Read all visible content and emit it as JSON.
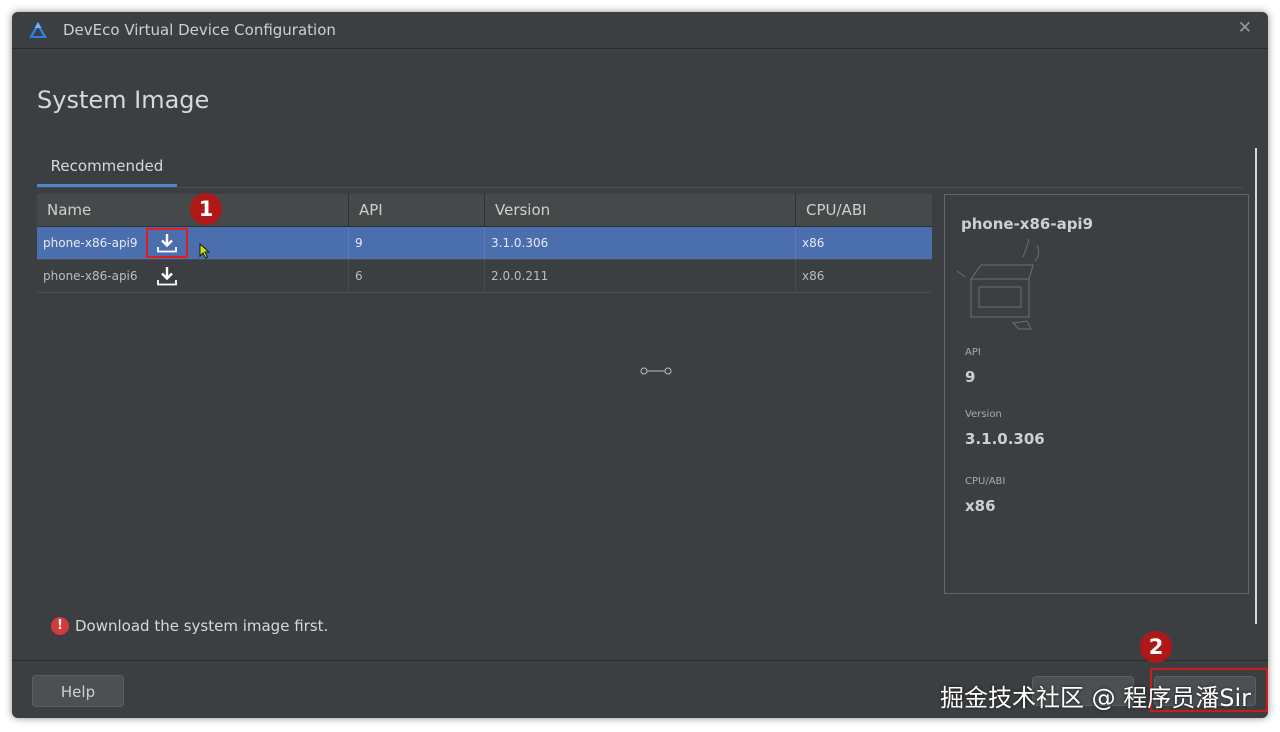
{
  "window": {
    "title": "DevEco Virtual Device Configuration"
  },
  "page": {
    "title": "System Image"
  },
  "tabs": [
    {
      "label": "Recommended",
      "selected": true
    }
  ],
  "table": {
    "headers": [
      "Name",
      "API",
      "Version",
      "CPU/ABI"
    ],
    "rows": [
      {
        "name": "phone-x86-api9",
        "api": "9",
        "version": "3.1.0.306",
        "cpu": "x86",
        "selected": true,
        "action_icon": "download-icon"
      },
      {
        "name": "phone-x86-api6",
        "api": "6",
        "version": "2.0.0.211",
        "cpu": "x86",
        "selected": false,
        "action_icon": "download-icon"
      }
    ]
  },
  "annotations": {
    "badge1": "1",
    "badge2": "2",
    "marker_color": "#d01a1a"
  },
  "details": {
    "title": "phone-x86-api9",
    "api_label": "API",
    "api_value": "9",
    "version_label": "Version",
    "version_value": "3.1.0.306",
    "cpu_label": "CPU/ABI",
    "cpu_value": "x86"
  },
  "status": {
    "message": "Download the system image first.",
    "icon": "error-icon"
  },
  "buttons": {
    "help": "Help"
  },
  "watermark": "掘金技术社区 @ 程序员潘Sir",
  "colors": {
    "selection": "#4b6eaf",
    "tab_underline": "#4a88c7",
    "background": "#3c3f41",
    "error": "#d33a3a"
  }
}
